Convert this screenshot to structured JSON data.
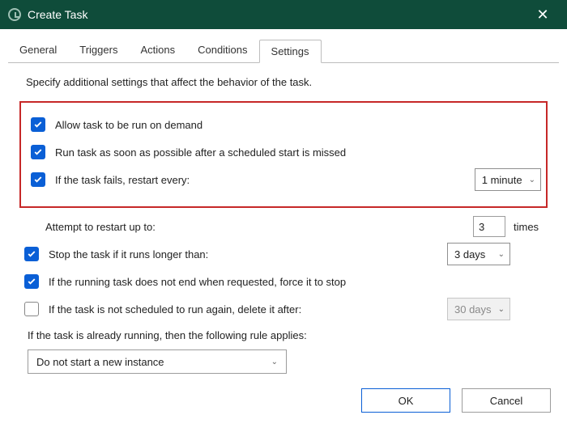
{
  "window": {
    "title": "Create Task"
  },
  "tabs": {
    "general": "General",
    "triggers": "Triggers",
    "actions": "Actions",
    "conditions": "Conditions",
    "settings": "Settings",
    "active": "settings"
  },
  "settings": {
    "description": "Specify additional settings that affect the behavior of the task.",
    "allow_on_demand": {
      "checked": true,
      "label": "Allow task to be run on demand"
    },
    "run_asap": {
      "checked": true,
      "label": "Run task as soon as possible after a scheduled start is missed"
    },
    "restart_on_fail": {
      "checked": true,
      "label": "If the task fails, restart every:",
      "value": "1 minute"
    },
    "attempt_restart": {
      "label": "Attempt to restart up to:",
      "value": "3",
      "suffix": "times"
    },
    "stop_long": {
      "checked": true,
      "label": "Stop the task if it runs longer than:",
      "value": "3 days"
    },
    "force_stop": {
      "checked": true,
      "label": "If the running task does not end when requested, force it to stop"
    },
    "delete_after": {
      "checked": false,
      "label": "If the task is not scheduled to run again, delete it after:",
      "value": "30 days"
    },
    "rule_label": "If the task is already running, then the following rule applies:",
    "rule_value": "Do not start a new instance"
  },
  "buttons": {
    "ok": "OK",
    "cancel": "Cancel"
  }
}
